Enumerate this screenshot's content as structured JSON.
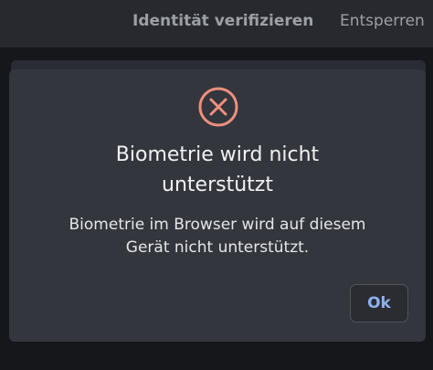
{
  "header": {
    "title": "Identität verifizieren",
    "action_label": "Entsperren"
  },
  "dialog": {
    "icon": "error-circle-x-icon",
    "title_line1": "Biometrie wird nicht",
    "title_line2": "unterstützt",
    "message_line1": "Biometrie im Browser wird auf diesem",
    "message_line2": "Gerät nicht unterstützt.",
    "ok_label": "Ok"
  },
  "colors": {
    "error_icon": "#ee8f7d",
    "accent": "#8db1ef",
    "dialog_bg": "#33363d"
  }
}
